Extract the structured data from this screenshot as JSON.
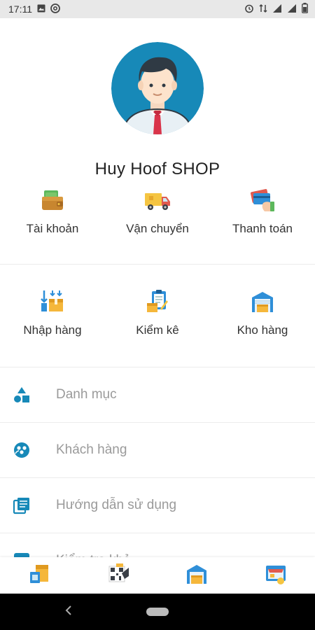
{
  "status_bar": {
    "time": "17:11",
    "left_icons": [
      "image-icon",
      "at-sign-icon"
    ],
    "right_icons": [
      "alarm-icon",
      "data-transfer-icon",
      "signal-icon",
      "signal-icon",
      "battery-icon"
    ]
  },
  "profile": {
    "shop_name": "Huy Hoof SHOP",
    "avatar_icon": "user-avatar-icon",
    "avatar_bg_color": "#1789b8"
  },
  "grid": {
    "row1": [
      {
        "label": "Tài khoản",
        "icon": "wallet-icon"
      },
      {
        "label": "Vận chuyển",
        "icon": "delivery-truck-icon"
      },
      {
        "label": "Thanh toán",
        "icon": "payment-card-icon"
      }
    ],
    "row2": [
      {
        "label": "Nhập hàng",
        "icon": "import-goods-icon"
      },
      {
        "label": "Kiểm kê",
        "icon": "inventory-clipboard-icon"
      },
      {
        "label": "Kho hàng",
        "icon": "warehouse-icon"
      }
    ]
  },
  "menu": {
    "items": [
      {
        "label": "Danh mục",
        "icon": "shapes-icon"
      },
      {
        "label": "Khách hàng",
        "icon": "customers-icon"
      },
      {
        "label": "Hướng dẫn sử dụng",
        "icon": "guide-book-icon"
      },
      {
        "label": "Kiểm tra khả",
        "icon": "check-icon"
      }
    ]
  },
  "bottom_nav": {
    "items": [
      {
        "icon": "orders-icon"
      },
      {
        "icon": "barcode-scanner-icon"
      },
      {
        "icon": "warehouse-icon"
      },
      {
        "icon": "store-icon"
      }
    ]
  },
  "colors": {
    "accent": "#1789b8",
    "label_gray": "#9a9a9a"
  }
}
